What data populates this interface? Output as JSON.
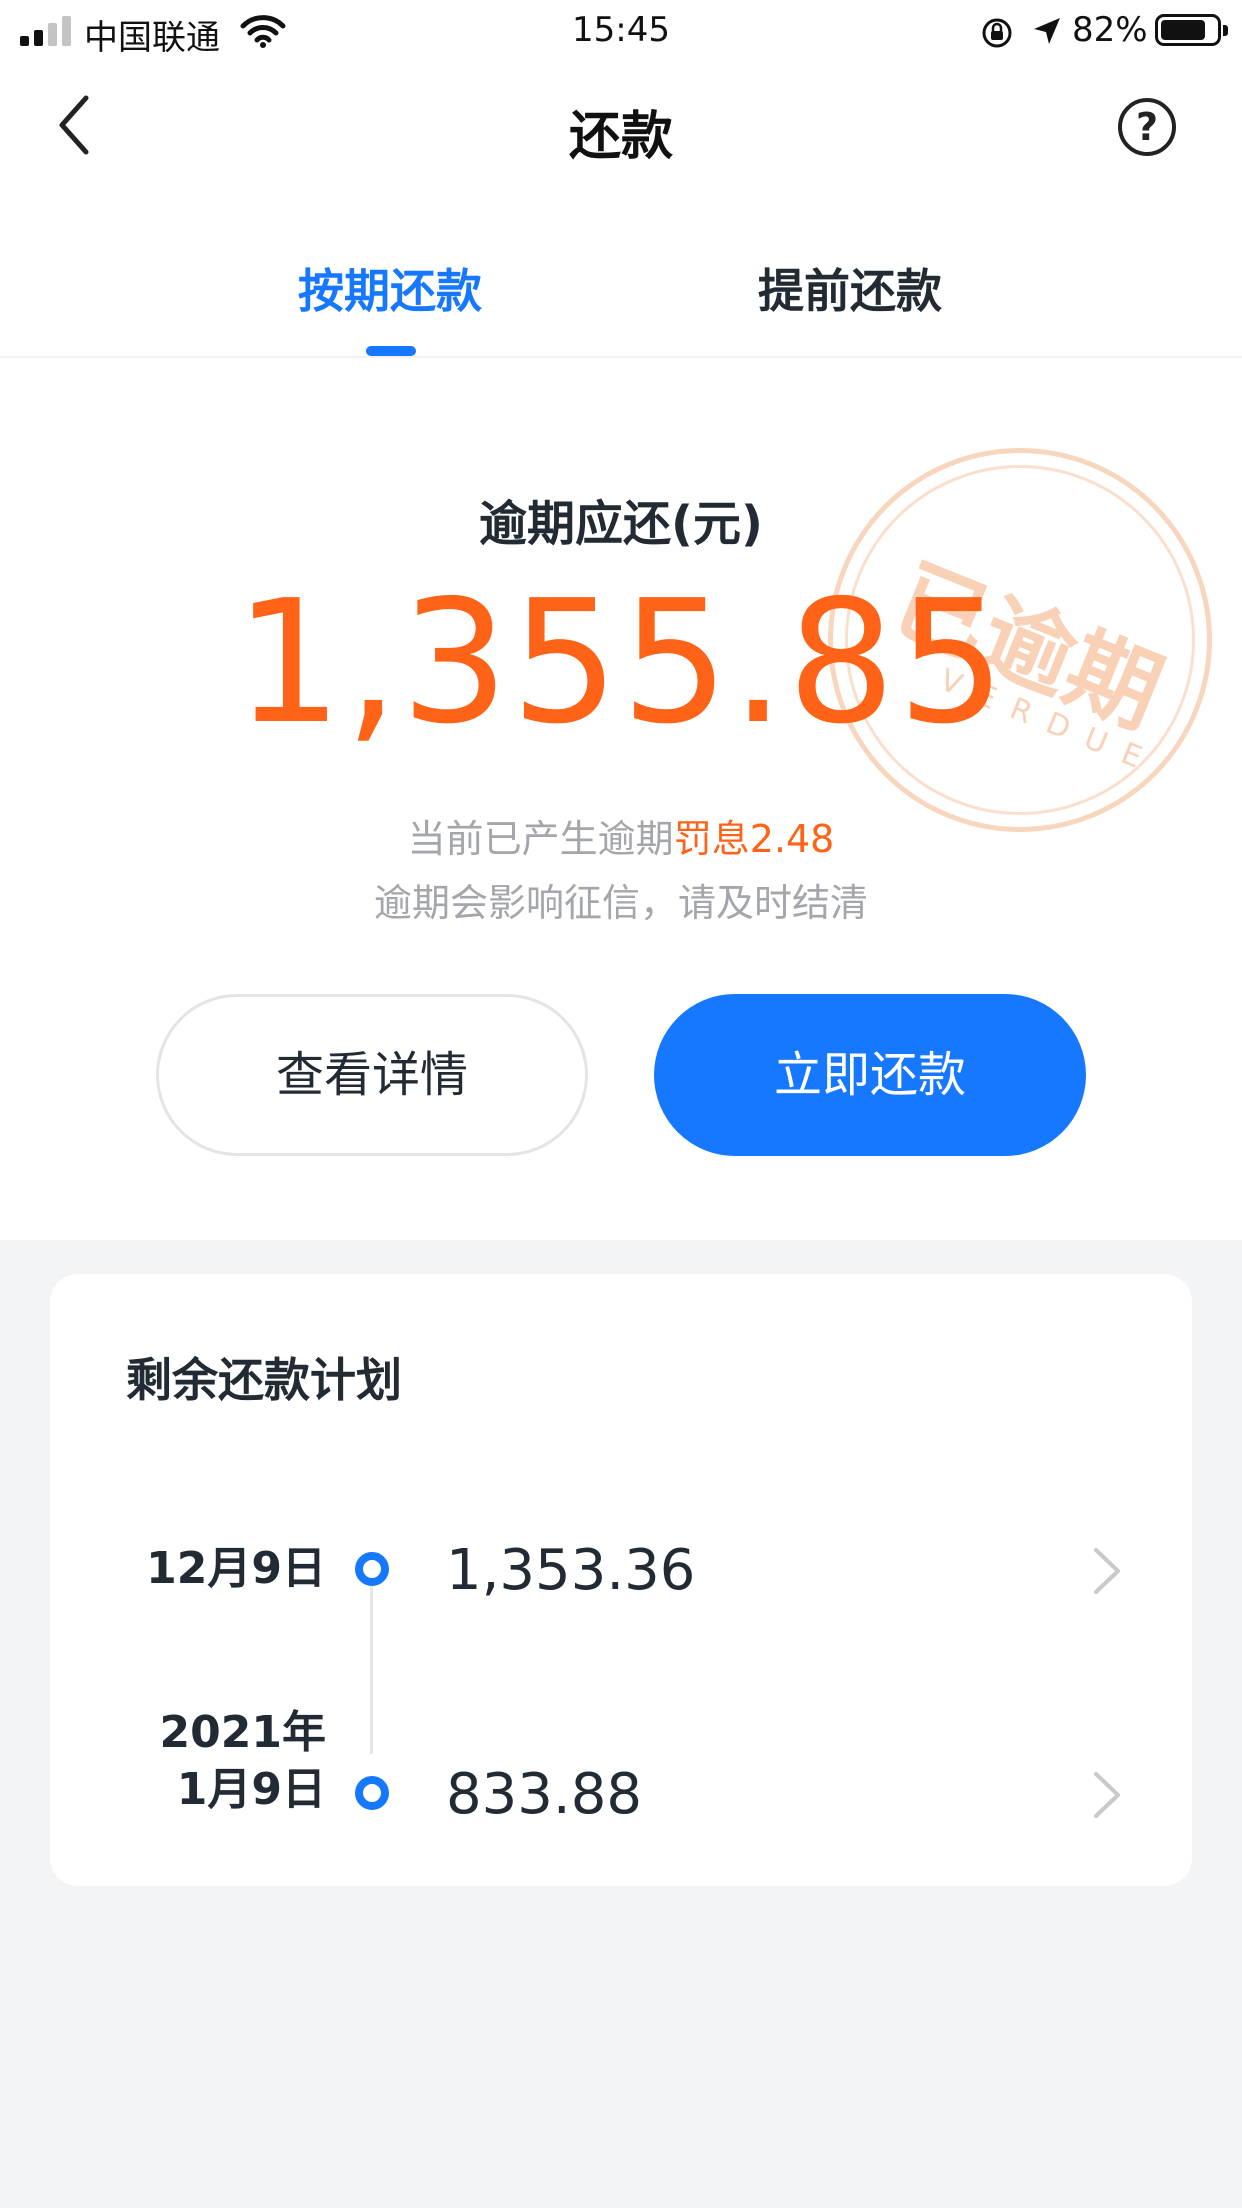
{
  "status_bar": {
    "carrier": "中国联通",
    "time": "15:45",
    "battery": "82%"
  },
  "nav": {
    "title": "还款",
    "help_symbol": "?"
  },
  "tabs": [
    {
      "label": "按期还款",
      "active": true
    },
    {
      "label": "提前还款",
      "active": false
    }
  ],
  "summary": {
    "label": "逾期应还(元)",
    "amount": "1,355.85",
    "penalty_prefix": "当前已产生逾期",
    "penalty_highlight": "罚息2.48",
    "warning": "逾期会影响征信，请及时结清",
    "stamp_text": "已逾期",
    "stamp_subtext": "VERDUE"
  },
  "buttons": {
    "detail": "查看详情",
    "pay": "立即还款"
  },
  "plan": {
    "title": "剩余还款计划",
    "items": [
      {
        "date": "12月9日",
        "amount": "1,353.36"
      },
      {
        "date_line1": "2021年",
        "date_line2": "1月9日",
        "amount": "833.88"
      }
    ]
  },
  "colors": {
    "accent": "#1677ff",
    "overdue": "#ff6317",
    "muted_text": "#a3a6ab"
  }
}
